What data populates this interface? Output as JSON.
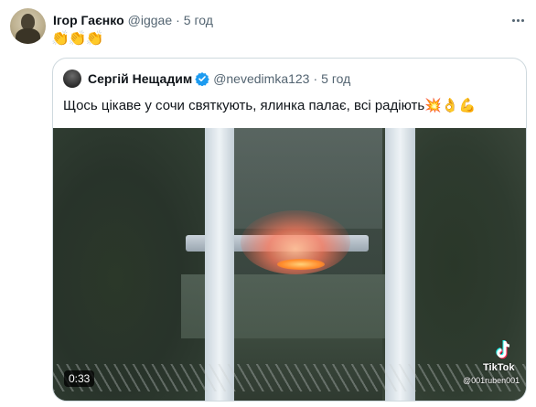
{
  "tweet": {
    "author_name": "Ігор Гаєнко",
    "author_handle": "@iggae",
    "separator": "·",
    "time": "5 год",
    "text": "👏👏👏"
  },
  "quote": {
    "author_name": "Сергій Нещадим",
    "author_handle": "@nevedimka123",
    "separator": "·",
    "time": "5 год",
    "text": "Щось цікаве у сочи святкують, ялинка палає, всі радіють💥👌💪",
    "video": {
      "duration": "0:33",
      "watermark_app": "TikTok",
      "watermark_user": "@001ruben001"
    }
  },
  "icons": {
    "more": "more-horizontal-icon",
    "verified": "verified-badge-icon",
    "tiktok": "tiktok-logo-icon"
  },
  "colors": {
    "verified": "#1d9bf0",
    "secondary_text": "#536471",
    "border": "#cfd9de"
  }
}
